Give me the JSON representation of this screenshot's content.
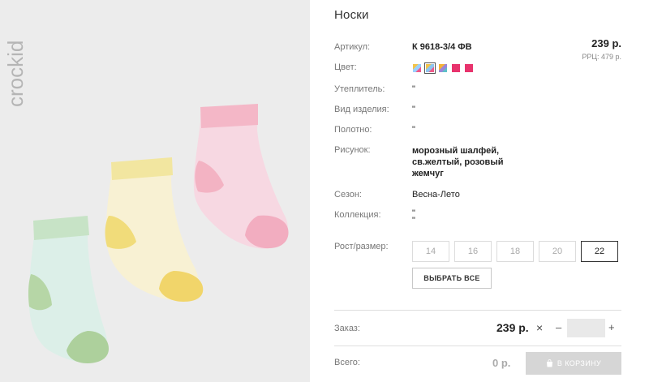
{
  "product": {
    "title": "Носки",
    "price": "239 р.",
    "rrp": "РРЦ: 479 р.",
    "brand": "crockid"
  },
  "specs": {
    "article_label": "Артикул:",
    "article_value": "К 9618-3/4 ФВ",
    "color_label": "Цвет:",
    "insulation_label": "Утеплитель:",
    "insulation_value": "\"",
    "item_type_label": "Вид изделия:",
    "item_type_value": "\"",
    "fabric_label": "Полотно:",
    "fabric_value": "\"",
    "pattern_label": "Рисунок:",
    "pattern_value": "морозный шалфей, св.желтый, розовый жемчуг",
    "season_label": "Сезон:",
    "season_value": "Весна-Лето",
    "collection_label": "Коллекция:",
    "collection_value_1": "\"",
    "collection_value_2": "\""
  },
  "swatches": [
    {
      "color": "multicolor",
      "selected": false
    },
    {
      "color": "multicolor",
      "selected": true
    },
    {
      "color": "multicolor",
      "selected": false
    },
    {
      "color": "#e8336d",
      "selected": false
    },
    {
      "color": "#e8336d",
      "selected": false
    }
  ],
  "sizes": {
    "label": "Рост/размер:",
    "options": [
      "14",
      "16",
      "18",
      "20",
      "22"
    ],
    "active": "22",
    "select_all": "ВЫБРАТЬ ВСЕ"
  },
  "order": {
    "label": "Заказ:",
    "price": "239 р.",
    "times": "×",
    "minus": "–",
    "plus": "+",
    "quantity": ""
  },
  "total": {
    "label": "Всего:",
    "price": "0 р.",
    "cart_button": "В КОРЗИНУ"
  }
}
